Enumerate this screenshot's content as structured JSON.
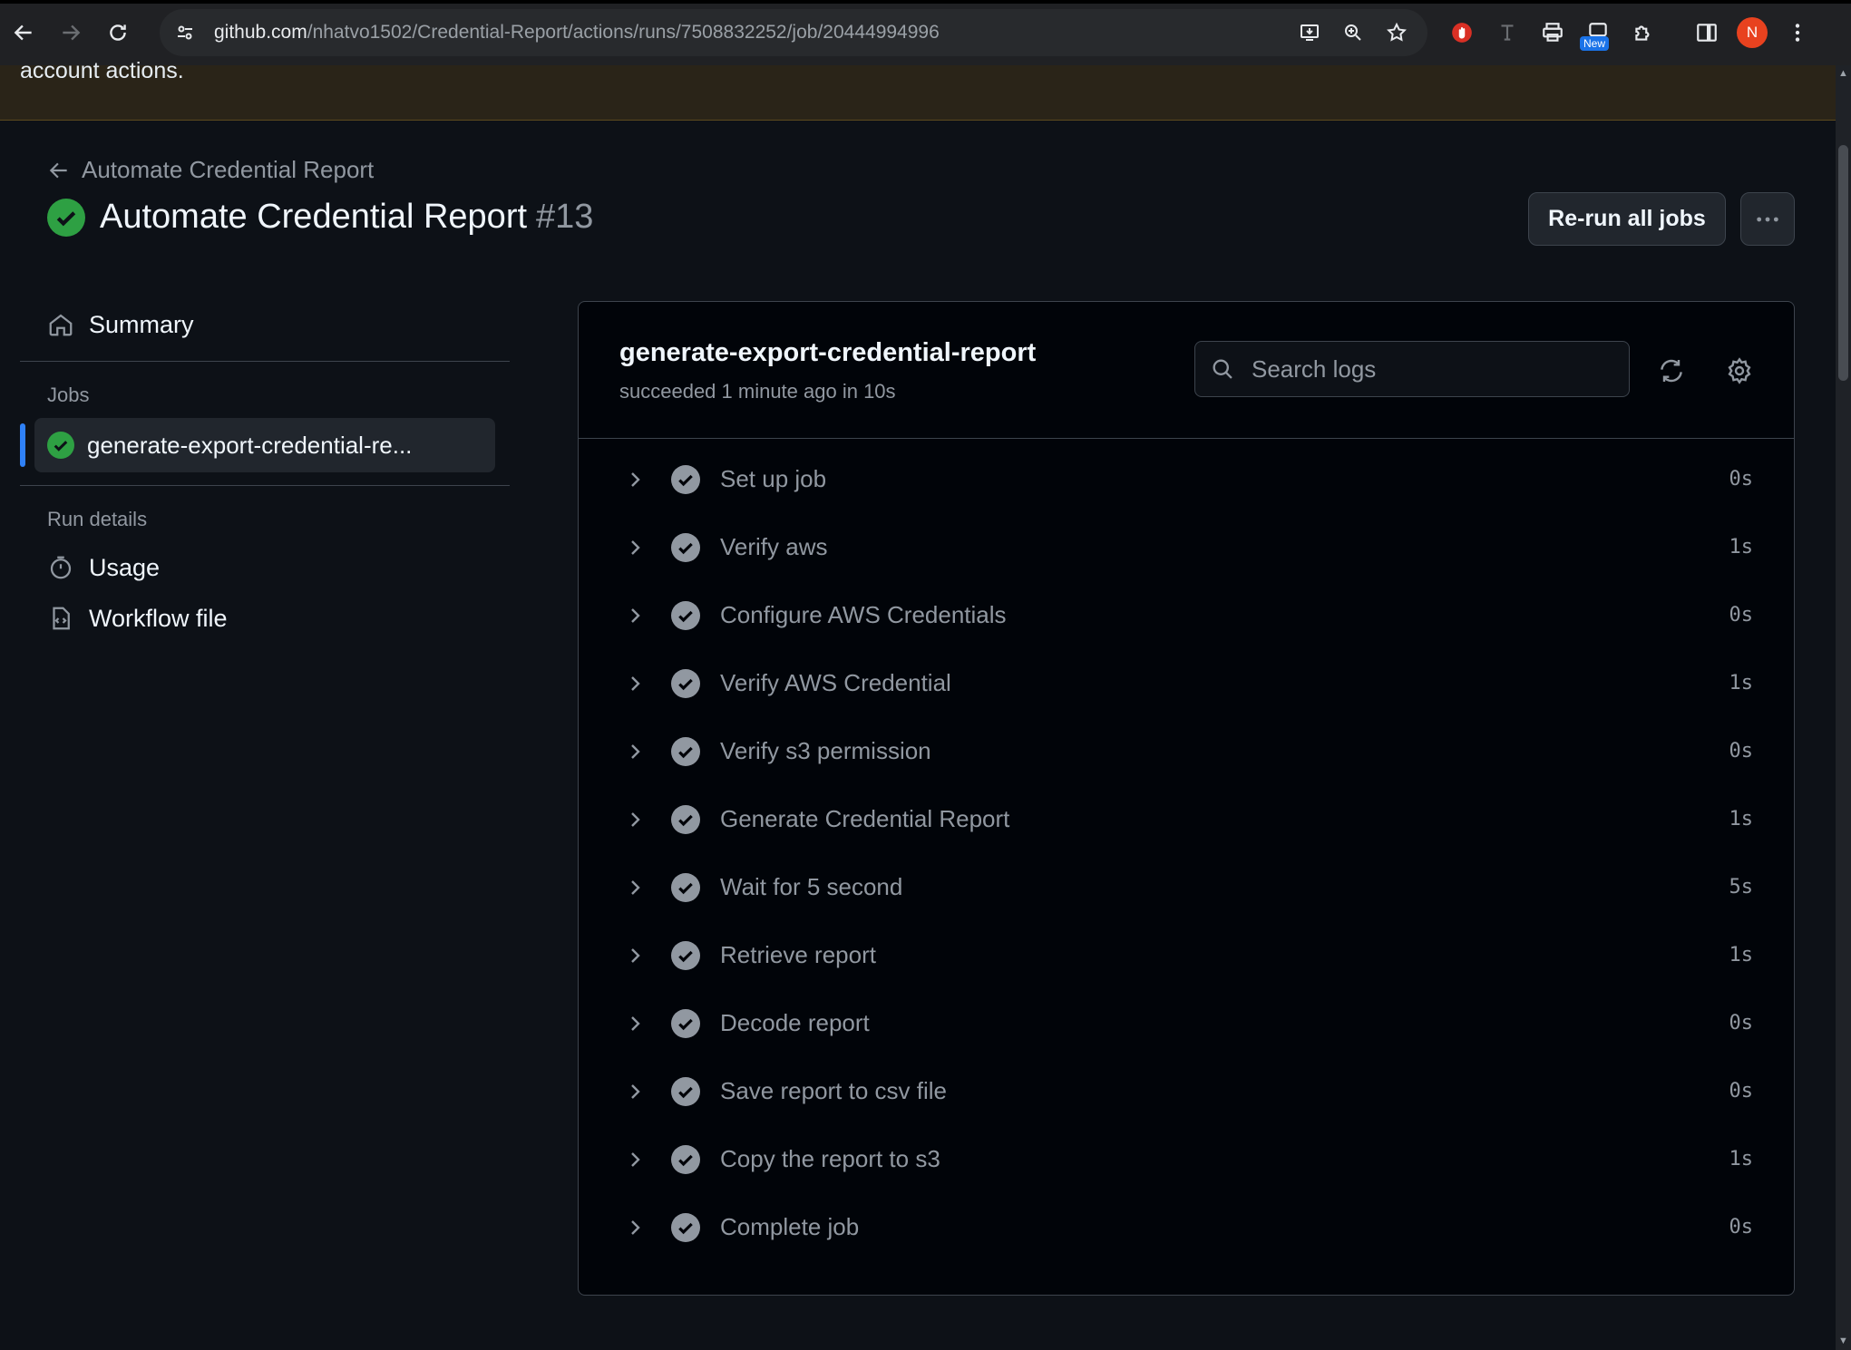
{
  "browser": {
    "url_host": "github.com",
    "url_path": "/nhatvo1502/Credential-Report/actions/runs/7508832252/job/20444994996",
    "new_badge": "New",
    "profile_initial": "N"
  },
  "banner": {
    "text": "account actions."
  },
  "header": {
    "back_label": "Automate Credential Report",
    "title": "Automate Credential Report",
    "run_number": "#13",
    "rerun_label": "Re-run all jobs"
  },
  "sidebar": {
    "summary_label": "Summary",
    "jobs_heading": "Jobs",
    "job_label": "generate-export-credential-re...",
    "run_details_heading": "Run details",
    "usage_label": "Usage",
    "workflow_label": "Workflow file"
  },
  "job": {
    "title": "generate-export-credential-report",
    "status": "succeeded 1 minute ago in 10s",
    "search_placeholder": "Search logs"
  },
  "steps": [
    {
      "name": "Set up job",
      "duration": "0s"
    },
    {
      "name": "Verify aws",
      "duration": "1s"
    },
    {
      "name": "Configure AWS Credentials",
      "duration": "0s"
    },
    {
      "name": "Verify AWS Credential",
      "duration": "1s"
    },
    {
      "name": "Verify s3 permission",
      "duration": "0s"
    },
    {
      "name": "Generate Credential Report",
      "duration": "1s"
    },
    {
      "name": "Wait for 5 second",
      "duration": "5s"
    },
    {
      "name": "Retrieve report",
      "duration": "1s"
    },
    {
      "name": "Decode report",
      "duration": "0s"
    },
    {
      "name": "Save report to csv file",
      "duration": "0s"
    },
    {
      "name": "Copy the report to s3",
      "duration": "1s"
    },
    {
      "name": "Complete job",
      "duration": "0s"
    }
  ],
  "colors": {
    "success": "#2ea043",
    "accent": "#2f81f7",
    "background": "#0d1117"
  }
}
